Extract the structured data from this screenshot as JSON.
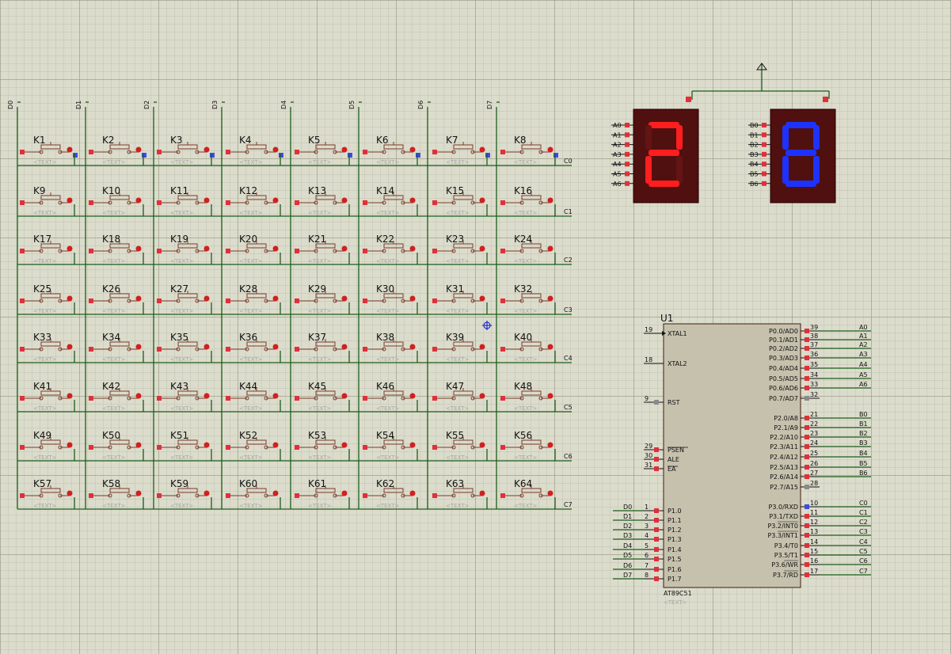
{
  "placeholder": "<TEXT>",
  "colors": {
    "wire": "#1a5e1a",
    "pin_red": "#e0303a",
    "pin_blue": "#3a4fe0",
    "chip_fill": "#c6c1ad",
    "display_bg": "#501010",
    "seg_red": "#ff1e1e",
    "seg_blue": "#1e32ff",
    "seg_off_red": "#641414",
    "seg_off_blue": "#1a1a6a"
  },
  "keypad": {
    "columns": [
      "D0",
      "D1",
      "D2",
      "D3",
      "D4",
      "D5",
      "D6",
      "D7"
    ],
    "rows": [
      "C0",
      "C1",
      "C2",
      "C3",
      "C4",
      "C5",
      "C6",
      "C7"
    ],
    "keys": [
      "K1",
      "K2",
      "K3",
      "K4",
      "K5",
      "K6",
      "K7",
      "K8",
      "K9",
      "K10",
      "K11",
      "K12",
      "K13",
      "K14",
      "K15",
      "K16",
      "K17",
      "K18",
      "K19",
      "K20",
      "K21",
      "K22",
      "K23",
      "K24",
      "K25",
      "K26",
      "K27",
      "K28",
      "K29",
      "K30",
      "K31",
      "K32",
      "K33",
      "K34",
      "K35",
      "K36",
      "K37",
      "K38",
      "K39",
      "K40",
      "K41",
      "K42",
      "K43",
      "K44",
      "K45",
      "K46",
      "K47",
      "K48",
      "K49",
      "K50",
      "K51",
      "K52",
      "K53",
      "K54",
      "K55",
      "K56",
      "K57",
      "K58",
      "K59",
      "K60",
      "K61",
      "K62",
      "K63",
      "K64"
    ]
  },
  "displays": [
    {
      "name": "display-left",
      "pins": [
        "A0",
        "A1",
        "A2",
        "A3",
        "A4",
        "A5",
        "A6"
      ],
      "digit": "2",
      "color": "red"
    },
    {
      "name": "display-right",
      "pins": [
        "B0",
        "B1",
        "B2",
        "B3",
        "B4",
        "B5",
        "B6"
      ],
      "digit": "8",
      "color": "blue"
    }
  ],
  "mcu": {
    "ref": "U1",
    "part": "AT89C51",
    "left_pins": [
      {
        "num": "19",
        "name": "XTAL1"
      },
      {
        "num": "18",
        "name": "XTAL2"
      },
      {
        "num": "9",
        "name": "RST"
      },
      {
        "num": "29",
        "name": "PSEN"
      },
      {
        "num": "30",
        "name": "ALE"
      },
      {
        "num": "31",
        "name": "EA"
      },
      {
        "num": "1",
        "name": "P1.0",
        "net": "D0"
      },
      {
        "num": "2",
        "name": "P1.1",
        "net": "D1"
      },
      {
        "num": "3",
        "name": "P1.2",
        "net": "D2"
      },
      {
        "num": "4",
        "name": "P1.3",
        "net": "D3"
      },
      {
        "num": "5",
        "name": "P1.4",
        "net": "D4"
      },
      {
        "num": "6",
        "name": "P1.5",
        "net": "D5"
      },
      {
        "num": "7",
        "name": "P1.6",
        "net": "D6"
      },
      {
        "num": "8",
        "name": "P1.7",
        "net": "D7"
      }
    ],
    "right_pins": [
      {
        "num": "39",
        "name": "P0.0/AD0",
        "net": "A0"
      },
      {
        "num": "38",
        "name": "P0.1/AD1",
        "net": "A1"
      },
      {
        "num": "37",
        "name": "P0.2/AD2",
        "net": "A2"
      },
      {
        "num": "36",
        "name": "P0.3/AD3",
        "net": "A3"
      },
      {
        "num": "35",
        "name": "P0.4/AD4",
        "net": "A4"
      },
      {
        "num": "34",
        "name": "P0.5/AD5",
        "net": "A5"
      },
      {
        "num": "33",
        "name": "P0.6/AD6",
        "net": "A6"
      },
      {
        "num": "32",
        "name": "P0.7/AD7",
        "net": ""
      },
      {
        "num": "21",
        "name": "P2.0/A8",
        "net": "B0"
      },
      {
        "num": "22",
        "name": "P2.1/A9",
        "net": "B1"
      },
      {
        "num": "23",
        "name": "P2.2/A10",
        "net": "B2"
      },
      {
        "num": "24",
        "name": "P2.3/A11",
        "net": "B3"
      },
      {
        "num": "25",
        "name": "P2.4/A12",
        "net": "B4"
      },
      {
        "num": "26",
        "name": "P2.5/A13",
        "net": "B5"
      },
      {
        "num": "27",
        "name": "P2.6/A14",
        "net": "B6"
      },
      {
        "num": "28",
        "name": "P2.7/A15",
        "net": ""
      },
      {
        "num": "10",
        "name": "P3.0/RXD",
        "net": "C0"
      },
      {
        "num": "11",
        "name": "P3.1/TXD",
        "net": "C1"
      },
      {
        "num": "12",
        "name": "P3.2/INT0",
        "net": "C2"
      },
      {
        "num": "13",
        "name": "P3.3/INT1",
        "net": "C3"
      },
      {
        "num": "14",
        "name": "P3.4/T0",
        "net": "C4"
      },
      {
        "num": "15",
        "name": "P3.5/T1",
        "net": "C5"
      },
      {
        "num": "16",
        "name": "P3.6/WR",
        "net": "C6"
      },
      {
        "num": "17",
        "name": "P3.7/RD",
        "net": "C7"
      }
    ]
  }
}
